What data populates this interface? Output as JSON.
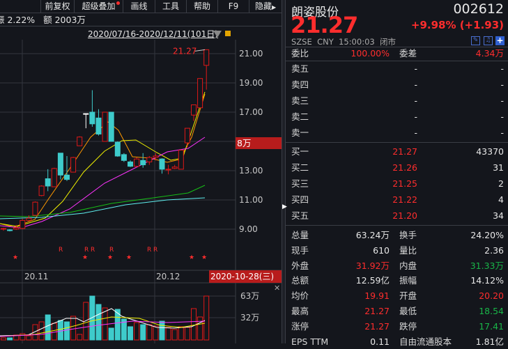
{
  "toolbar": {
    "items": [
      "前复权",
      "超级叠加",
      "画线",
      "工具",
      "帮助",
      "F9",
      "隐藏"
    ]
  },
  "info_line": {
    "amplitude": "振 2.22%",
    "amount": "额 2003万"
  },
  "range": "2020/07/16-2020/12/11(101日)",
  "chart": {
    "price_ticks": [
      "21.00",
      "19.00",
      "17.00",
      "15.00",
      "13.00",
      "11.00",
      "9.00"
    ],
    "tick_values": [
      21,
      19,
      17,
      15,
      13,
      11,
      9
    ],
    "last_price_label": "21.27",
    "cursor_label": "8万",
    "x_labels": [
      "20.11",
      "20.12"
    ],
    "cursor_date": "2020-10-28(三)",
    "marks_r": "R",
    "candles": [
      [
        9.0,
        9.05,
        8.9,
        9.1
      ],
      [
        8.95,
        8.9,
        8.85,
        9.0
      ],
      [
        9.0,
        9.1,
        8.95,
        9.3
      ],
      [
        9.05,
        9.6,
        9.0,
        9.7
      ],
      [
        9.6,
        9.75,
        9.55,
        9.95
      ],
      [
        9.95,
        10.85,
        9.9,
        10.9
      ],
      [
        11.3,
        11.95,
        11.25,
        12.0
      ],
      [
        12.45,
        11.95,
        11.6,
        13.1
      ],
      [
        11.9,
        13.15,
        11.9,
        13.2
      ],
      [
        14.2,
        12.7,
        12.4,
        14.2
      ],
      [
        12.7,
        12.4,
        12.3,
        14.0
      ],
      [
        12.9,
        13.9,
        12.9,
        13.95
      ],
      [
        14.7,
        15.3,
        14.7,
        15.35
      ],
      [
        16.9,
        16.9,
        15.9,
        16.9
      ],
      [
        17.0,
        16.2,
        16.0,
        18.5
      ],
      [
        16.6,
        15.5,
        15.4,
        17.2
      ],
      [
        15.0,
        17.0,
        15.0,
        17.0
      ],
      [
        17.0,
        15.0,
        15.0,
        17.0
      ],
      [
        14.95,
        14.0,
        13.95,
        15.0
      ],
      [
        14.1,
        13.7,
        13.6,
        14.2
      ],
      [
        13.6,
        13.3,
        13.25,
        13.7
      ],
      [
        13.3,
        13.8,
        13.25,
        13.9
      ],
      [
        13.7,
        13.4,
        13.2,
        14.2
      ],
      [
        13.6,
        13.9,
        13.4,
        14.0
      ],
      [
        13.9,
        14.0,
        13.7,
        14.2
      ],
      [
        13.8,
        13.1,
        12.8,
        13.85
      ],
      [
        13.05,
        13.1,
        12.75,
        13.4
      ],
      [
        13.15,
        13.25,
        13.1,
        13.4
      ],
      [
        13.1,
        14.4,
        13.1,
        14.45
      ],
      [
        14.9,
        15.9,
        14.6,
        15.9
      ],
      [
        16.8,
        17.5,
        16.4,
        17.5
      ],
      [
        17.3,
        19.3,
        17.3,
        19.3
      ],
      [
        20.2,
        21.27,
        18.54,
        21.27
      ]
    ],
    "volume_ticks": [
      "63万",
      "32万"
    ],
    "volumes": [
      3,
      3,
      7,
      9,
      6,
      22,
      26,
      36,
      24,
      28,
      26,
      34,
      8,
      54,
      63,
      51,
      46,
      17,
      44,
      30,
      19,
      25,
      22,
      22,
      20,
      27,
      18,
      15,
      19,
      18,
      45,
      33,
      63
    ]
  },
  "quote": {
    "name": "朗姿股份",
    "code": "002612",
    "price": "21.27",
    "change": "+9.98% (+1.93)",
    "exchange": "SZSE",
    "currency": "CNY",
    "time": "15:00:03",
    "status": "闭市",
    "weibi_label": "委比",
    "weibi": "100.00%",
    "weicha_label": "委差",
    "weicha": "4.34万",
    "asks": [
      {
        "label": "卖五",
        "price": "-",
        "vol": "-"
      },
      {
        "label": "卖四",
        "price": "-",
        "vol": "-"
      },
      {
        "label": "卖三",
        "price": "-",
        "vol": "-"
      },
      {
        "label": "卖二",
        "price": "-",
        "vol": "-"
      },
      {
        "label": "卖一",
        "price": "-",
        "vol": "-"
      }
    ],
    "bids": [
      {
        "label": "买一",
        "price": "21.27",
        "vol": "43370"
      },
      {
        "label": "买二",
        "price": "21.26",
        "vol": "31"
      },
      {
        "label": "买三",
        "price": "21.25",
        "vol": "2"
      },
      {
        "label": "买四",
        "price": "21.22",
        "vol": "4"
      },
      {
        "label": "买五",
        "price": "21.20",
        "vol": "34"
      }
    ],
    "stats": [
      {
        "l1": "总量",
        "v1": "63.24万",
        "c1": "white",
        "l2": "换手",
        "v2": "24.20%",
        "c2": "white"
      },
      {
        "l1": "现手",
        "v1": "610",
        "c1": "white",
        "l2": "量比",
        "v2": "2.36",
        "c2": "white"
      },
      {
        "l1": "外盘",
        "v1": "31.92万",
        "c1": "red",
        "l2": "内盘",
        "v2": "31.33万",
        "c2": "green"
      },
      {
        "l1": "总额",
        "v1": "12.59亿",
        "c1": "white",
        "l2": "振幅",
        "v2": "14.12%",
        "c2": "white"
      },
      {
        "l1": "均价",
        "v1": "19.91",
        "c1": "red",
        "l2": "开盘",
        "v2": "20.20",
        "c2": "red"
      },
      {
        "l1": "最高",
        "v1": "21.27",
        "c1": "red",
        "l2": "最低",
        "v2": "18.54",
        "c2": "green"
      },
      {
        "l1": "涨停",
        "v1": "21.27",
        "c1": "red",
        "l2": "跌停",
        "v2": "17.41",
        "c2": "green"
      },
      {
        "l1": "EPS TTM",
        "v1": "0.11",
        "c1": "white",
        "l2": "自由流通股本",
        "v2": "1.81亿",
        "c2": "white"
      }
    ]
  },
  "colors": {
    "up": "#e01818",
    "down": "#3ecbcb",
    "accent": "#b81c1c"
  }
}
